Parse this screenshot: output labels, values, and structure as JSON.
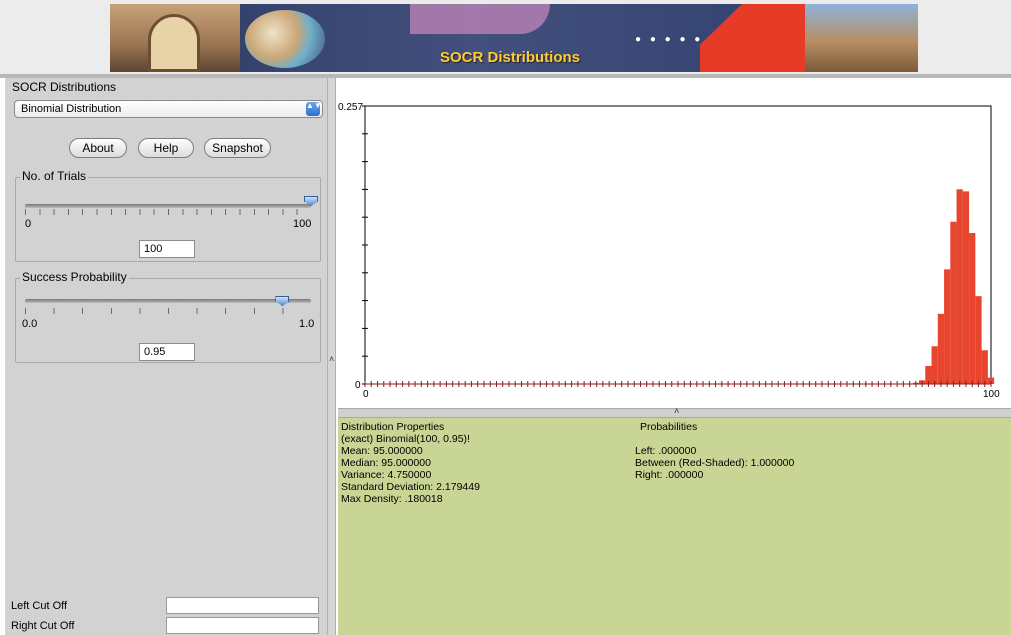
{
  "banner": {
    "title": "SOCR Distributions",
    "dots_text": "● ● ● ● ●"
  },
  "left_panel": {
    "group_title": "SOCR Distributions",
    "distribution_select": {
      "value": "Binomial Distribution",
      "spinner_glyph": "▲▼"
    },
    "buttons": {
      "about": "About",
      "help": "Help",
      "snapshot": "Snapshot"
    },
    "trials": {
      "label": "No. of Trials",
      "min_label": "0",
      "max_label": "100",
      "value": "100",
      "slider_fraction": 1.0
    },
    "success": {
      "label": "Success Probability",
      "min_label": "0.0",
      "max_label": "1.0",
      "value": "0.95",
      "slider_fraction": 0.9
    },
    "left_cut_label": "Left Cut Off",
    "right_cut_label": "Right Cut Off",
    "left_cut_value": "",
    "right_cut_value": ""
  },
  "splitters": {
    "vertical_arrow": "˄",
    "horizontal_arrow": "˄"
  },
  "chart_data": {
    "type": "bar",
    "title": "",
    "xlabel": "",
    "ylabel": "",
    "x_tick_labels": [
      "0",
      "100"
    ],
    "y_tick_labels": [
      "0",
      "0.257"
    ],
    "xlim": [
      0,
      100
    ],
    "ylim": [
      0,
      0.257
    ],
    "bar_color": "#e8452e",
    "axis_marker_color": "#8b1a1a",
    "x": [
      88,
      89,
      90,
      91,
      92,
      93,
      94,
      95,
      96,
      97,
      98,
      99,
      100
    ],
    "values": [
      0.0011,
      0.0034,
      0.0167,
      0.0349,
      0.0649,
      0.106,
      0.15,
      0.18,
      0.1781,
      0.1396,
      0.0812,
      0.0312,
      0.0059
    ]
  },
  "stats": {
    "properties_header": "Distribution Properties",
    "distribution_line": "(exact) Binomial(100, 0.95)!",
    "mean": "Mean: 95.000000",
    "median": "Median: 95.000000",
    "variance": "Variance: 4.750000",
    "std_dev": "Standard Deviation: 2.179449",
    "max_density": "Max Density: .180018",
    "probabilities_header": "Probabilities",
    "left": "Left: .000000",
    "between": "Between (Red-Shaded): 1.000000",
    "right": "Right: .000000"
  }
}
